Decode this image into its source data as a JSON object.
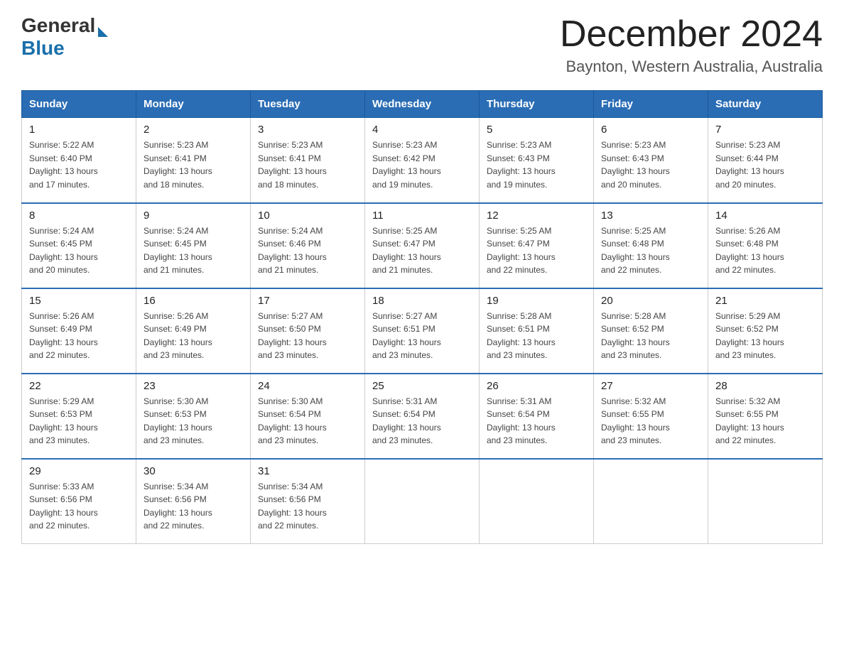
{
  "header": {
    "logo_general": "General",
    "logo_blue": "Blue",
    "month_title": "December 2024",
    "location": "Baynton, Western Australia, Australia"
  },
  "weekdays": [
    "Sunday",
    "Monday",
    "Tuesday",
    "Wednesday",
    "Thursday",
    "Friday",
    "Saturday"
  ],
  "weeks": [
    [
      {
        "day": "1",
        "sunrise": "5:22 AM",
        "sunset": "6:40 PM",
        "daylight": "13 hours and 17 minutes."
      },
      {
        "day": "2",
        "sunrise": "5:23 AM",
        "sunset": "6:41 PM",
        "daylight": "13 hours and 18 minutes."
      },
      {
        "day": "3",
        "sunrise": "5:23 AM",
        "sunset": "6:41 PM",
        "daylight": "13 hours and 18 minutes."
      },
      {
        "day": "4",
        "sunrise": "5:23 AM",
        "sunset": "6:42 PM",
        "daylight": "13 hours and 19 minutes."
      },
      {
        "day": "5",
        "sunrise": "5:23 AM",
        "sunset": "6:43 PM",
        "daylight": "13 hours and 19 minutes."
      },
      {
        "day": "6",
        "sunrise": "5:23 AM",
        "sunset": "6:43 PM",
        "daylight": "13 hours and 20 minutes."
      },
      {
        "day": "7",
        "sunrise": "5:23 AM",
        "sunset": "6:44 PM",
        "daylight": "13 hours and 20 minutes."
      }
    ],
    [
      {
        "day": "8",
        "sunrise": "5:24 AM",
        "sunset": "6:45 PM",
        "daylight": "13 hours and 20 minutes."
      },
      {
        "day": "9",
        "sunrise": "5:24 AM",
        "sunset": "6:45 PM",
        "daylight": "13 hours and 21 minutes."
      },
      {
        "day": "10",
        "sunrise": "5:24 AM",
        "sunset": "6:46 PM",
        "daylight": "13 hours and 21 minutes."
      },
      {
        "day": "11",
        "sunrise": "5:25 AM",
        "sunset": "6:47 PM",
        "daylight": "13 hours and 21 minutes."
      },
      {
        "day": "12",
        "sunrise": "5:25 AM",
        "sunset": "6:47 PM",
        "daylight": "13 hours and 22 minutes."
      },
      {
        "day": "13",
        "sunrise": "5:25 AM",
        "sunset": "6:48 PM",
        "daylight": "13 hours and 22 minutes."
      },
      {
        "day": "14",
        "sunrise": "5:26 AM",
        "sunset": "6:48 PM",
        "daylight": "13 hours and 22 minutes."
      }
    ],
    [
      {
        "day": "15",
        "sunrise": "5:26 AM",
        "sunset": "6:49 PM",
        "daylight": "13 hours and 22 minutes."
      },
      {
        "day": "16",
        "sunrise": "5:26 AM",
        "sunset": "6:49 PM",
        "daylight": "13 hours and 23 minutes."
      },
      {
        "day": "17",
        "sunrise": "5:27 AM",
        "sunset": "6:50 PM",
        "daylight": "13 hours and 23 minutes."
      },
      {
        "day": "18",
        "sunrise": "5:27 AM",
        "sunset": "6:51 PM",
        "daylight": "13 hours and 23 minutes."
      },
      {
        "day": "19",
        "sunrise": "5:28 AM",
        "sunset": "6:51 PM",
        "daylight": "13 hours and 23 minutes."
      },
      {
        "day": "20",
        "sunrise": "5:28 AM",
        "sunset": "6:52 PM",
        "daylight": "13 hours and 23 minutes."
      },
      {
        "day": "21",
        "sunrise": "5:29 AM",
        "sunset": "6:52 PM",
        "daylight": "13 hours and 23 minutes."
      }
    ],
    [
      {
        "day": "22",
        "sunrise": "5:29 AM",
        "sunset": "6:53 PM",
        "daylight": "13 hours and 23 minutes."
      },
      {
        "day": "23",
        "sunrise": "5:30 AM",
        "sunset": "6:53 PM",
        "daylight": "13 hours and 23 minutes."
      },
      {
        "day": "24",
        "sunrise": "5:30 AM",
        "sunset": "6:54 PM",
        "daylight": "13 hours and 23 minutes."
      },
      {
        "day": "25",
        "sunrise": "5:31 AM",
        "sunset": "6:54 PM",
        "daylight": "13 hours and 23 minutes."
      },
      {
        "day": "26",
        "sunrise": "5:31 AM",
        "sunset": "6:54 PM",
        "daylight": "13 hours and 23 minutes."
      },
      {
        "day": "27",
        "sunrise": "5:32 AM",
        "sunset": "6:55 PM",
        "daylight": "13 hours and 23 minutes."
      },
      {
        "day": "28",
        "sunrise": "5:32 AM",
        "sunset": "6:55 PM",
        "daylight": "13 hours and 22 minutes."
      }
    ],
    [
      {
        "day": "29",
        "sunrise": "5:33 AM",
        "sunset": "6:56 PM",
        "daylight": "13 hours and 22 minutes."
      },
      {
        "day": "30",
        "sunrise": "5:34 AM",
        "sunset": "6:56 PM",
        "daylight": "13 hours and 22 minutes."
      },
      {
        "day": "31",
        "sunrise": "5:34 AM",
        "sunset": "6:56 PM",
        "daylight": "13 hours and 22 minutes."
      },
      null,
      null,
      null,
      null
    ]
  ],
  "labels": {
    "sunrise": "Sunrise:",
    "sunset": "Sunset:",
    "daylight": "Daylight:"
  }
}
